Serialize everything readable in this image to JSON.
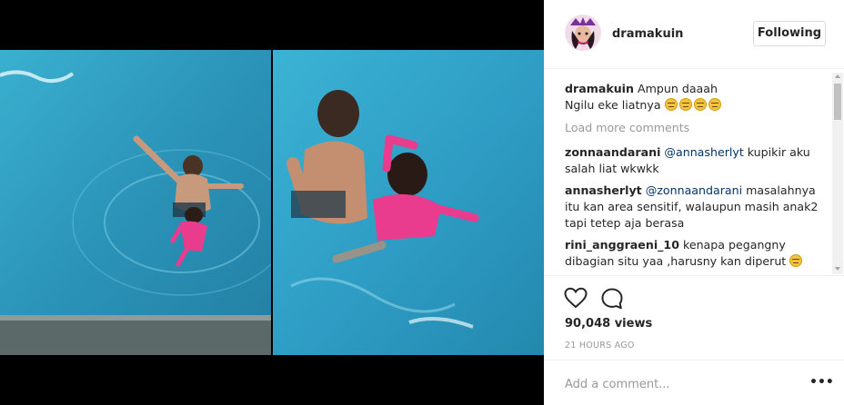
{
  "post": {
    "username": "dramakuin",
    "follow_label": "Following",
    "caption": {
      "user": "dramakuin",
      "line1": "Ampun daaah",
      "line2": "Ngilu eke liatnya",
      "emoji": [
        "expressionless-face",
        "expressionless-face",
        "expressionless-face",
        "expressionless-face"
      ]
    },
    "load_more": "Load more comments",
    "comments": [
      {
        "user": "zonnaandarani",
        "mention": "@annasherlyt",
        "text": "kupikir aku salah liat wkwkk"
      },
      {
        "user": "annasherlyt",
        "mention": "@zonnaandarani",
        "text": "masalahnya itu kan area sensitif, walaupun masih anak2 tapi tetep aja berasa"
      },
      {
        "user": "rini_anggraeni_10",
        "text": "kenapa pegangny dibagian situ yaa ,harusny kan diperut",
        "emoji": "thinking-face"
      }
    ],
    "views": "90,048 views",
    "time": "21 HOURS AGO",
    "add_comment_placeholder": "Add a comment...",
    "more_glyph": "•••"
  },
  "icons": {
    "like": "heart-icon",
    "comment": "speech-bubble-icon",
    "more": "more-options-icon"
  },
  "colors": {
    "pool_water": "#2f9fc4",
    "swimsuit_pink": "#e93c8e",
    "mention_blue": "#003569",
    "muted_gray": "#999999"
  }
}
